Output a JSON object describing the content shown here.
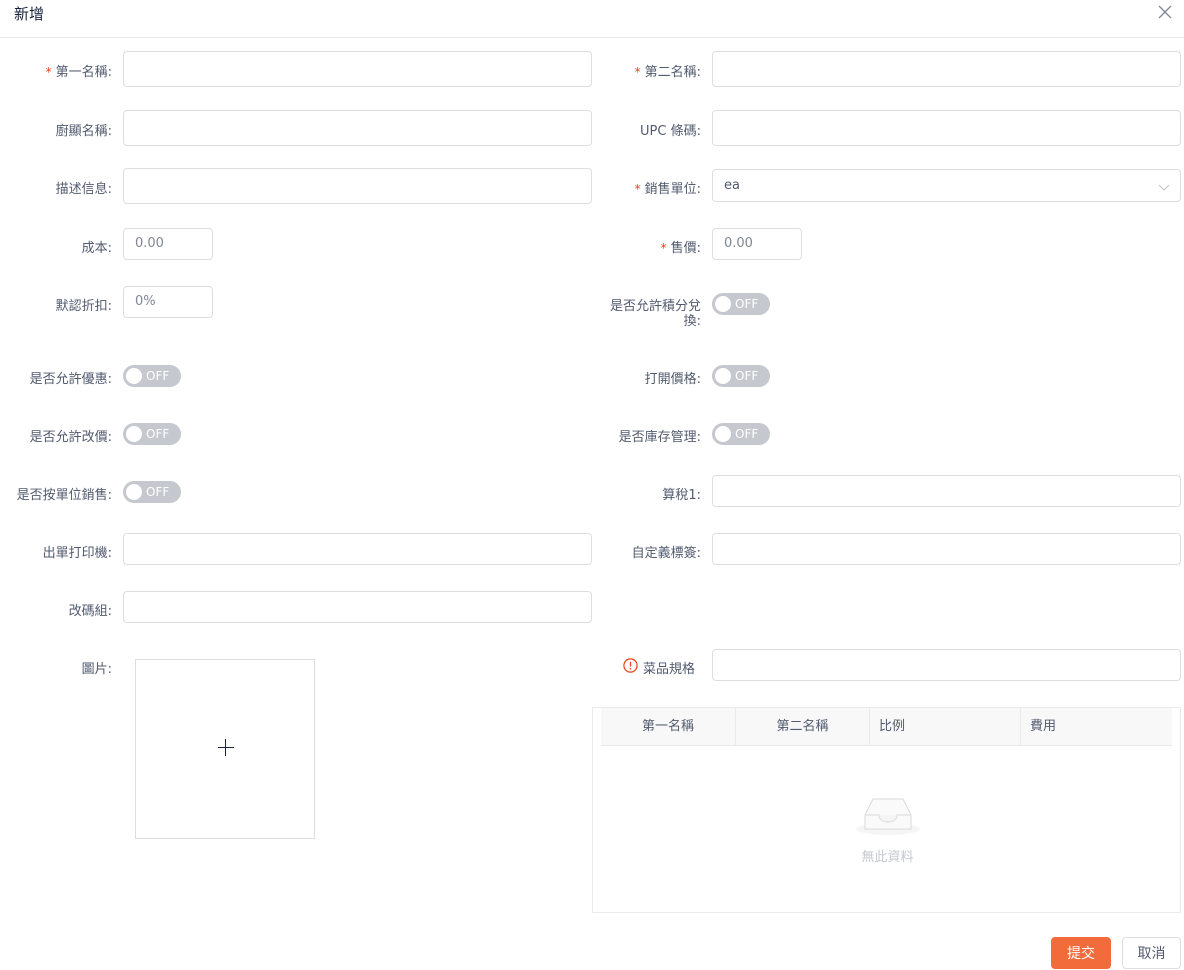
{
  "dialog": {
    "title": "新增",
    "close_icon": "close-icon"
  },
  "form": {
    "first_name": {
      "label": "第一名稱:",
      "value": ""
    },
    "second_name": {
      "label": "第二名稱:",
      "value": ""
    },
    "kitchen_name": {
      "label": "廚顯名稱:",
      "value": ""
    },
    "upc": {
      "label": "UPC 條碼:",
      "value": ""
    },
    "description": {
      "label": "描述信息:",
      "value": ""
    },
    "sales_unit": {
      "label": "銷售單位:",
      "value": "ea"
    },
    "cost": {
      "label": "成本:",
      "placeholder": "0.00"
    },
    "price": {
      "label": "售價:",
      "placeholder": "0.00"
    },
    "discount": {
      "label": "默認折扣:",
      "placeholder": "0%"
    },
    "points_label_1": "是否允許積分兌",
    "points_label_2": "換:",
    "allow_promo": {
      "label": "是否允許優惠:"
    },
    "open_price": {
      "label": "打開價格:"
    },
    "allow_change_price": {
      "label": "是否允許改價:"
    },
    "inventory": {
      "label": "是否庫存管理:"
    },
    "sell_by_unit": {
      "label": "是否按單位銷售:"
    },
    "tax1": {
      "label": "算稅1:",
      "value": ""
    },
    "printer": {
      "label": "出單打印機:",
      "value": ""
    },
    "custom_tag": {
      "label": "自定義標簽:",
      "value": ""
    },
    "modifier_group": {
      "label": "改碼組:",
      "value": ""
    },
    "image": {
      "label": "圖片:"
    },
    "spec": {
      "label": "菜品規格",
      "value": ""
    },
    "switch_off": "OFF"
  },
  "spec_table": {
    "columns": [
      "第一名稱",
      "第二名稱",
      "比例",
      "費用"
    ],
    "empty_text": "無此資料"
  },
  "buttons": {
    "submit": "提交",
    "cancel": "取消"
  },
  "colors": {
    "primary": "#f26b3a",
    "required": "#ed4014",
    "switch_off": "#c5c8ce"
  }
}
